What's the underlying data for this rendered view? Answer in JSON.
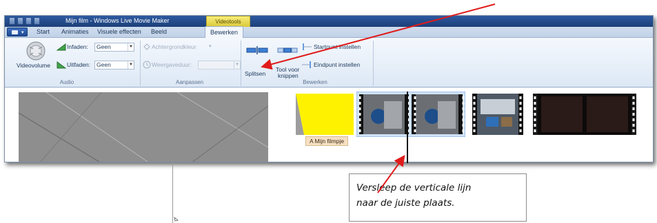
{
  "top_caption": "                                                ",
  "window": {
    "title": "Mijn film - Windows Live Movie Maker",
    "context_tab": "Videotools"
  },
  "tabs": [
    {
      "label": "Start",
      "active": false
    },
    {
      "label": "Animaties",
      "active": false
    },
    {
      "label": "Visuele effecten",
      "active": false
    },
    {
      "label": "Beeld",
      "active": false
    },
    {
      "label": "Bewerken",
      "active": true
    }
  ],
  "ribbon": {
    "audio": {
      "volume_label": "Videovolume",
      "fade_in_label": "Infaden:",
      "fade_in_value": "Geen",
      "fade_out_label": "Uitfaden:",
      "fade_out_value": "Geen",
      "group_label": "Audio"
    },
    "adjust": {
      "background_color_label": "Achtergrondkleur",
      "duration_label": "Weergaveduur:",
      "duration_value": "",
      "group_label": "Aanpassen"
    },
    "edit": {
      "split_label": "Splitsen",
      "trim_tool_label_line1": "Tool voor",
      "trim_tool_label_line2": "knippen",
      "start_point_label": "Startpunt instellen",
      "end_point_label": "Eindpunt instellen",
      "group_label": "Bewerken"
    }
  },
  "storyboard": {
    "caption_label": "A  Mijn filmpje"
  },
  "callout": {
    "line1": "Versleep de verticale lijn",
    "line2": "naar de juiste plaats."
  },
  "colors": {
    "arrow": "#e01b1b",
    "context_tab": "#e8da52",
    "title_caption_chip": "#f6e0c2",
    "clip_yellow": "#fff200"
  }
}
